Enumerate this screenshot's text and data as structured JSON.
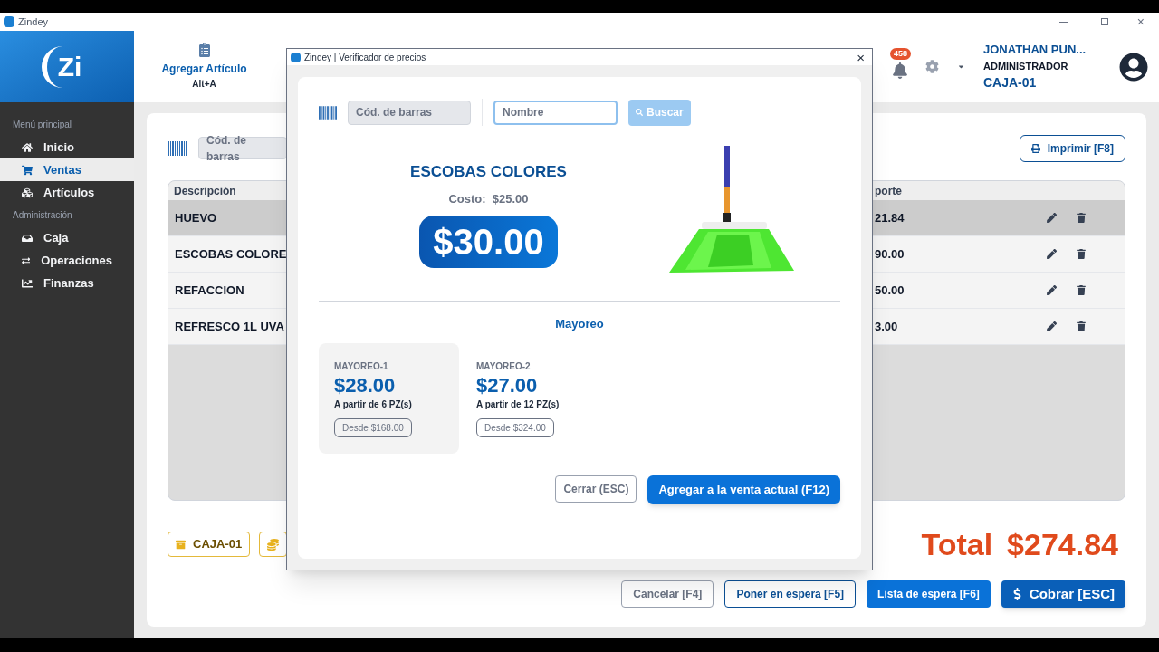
{
  "window": {
    "title": "Zindey",
    "close": "×"
  },
  "sidebar": {
    "logo": "Zi",
    "sections": [
      {
        "title": "Menú principal",
        "items": [
          {
            "label": "Inicio",
            "selected": false
          },
          {
            "label": "Ventas",
            "selected": true
          },
          {
            "label": "Artículos",
            "selected": false
          }
        ]
      },
      {
        "title": "Administración",
        "items": [
          {
            "label": "Caja",
            "selected": false
          },
          {
            "label": "Operaciones",
            "selected": false
          },
          {
            "label": "Finanzas",
            "selected": false
          }
        ]
      }
    ]
  },
  "toolbar": {
    "add_item": {
      "label": "Agregar Artículo",
      "shortcut": "Alt+A"
    },
    "notifications": "458",
    "user": {
      "name": "JONATHAN PUN...",
      "role": "ADMINISTRADOR",
      "register": "CAJA-01"
    }
  },
  "sale": {
    "barcode_placeholder": "Cód. de barras",
    "print_button": "Imprimir [F8]",
    "columns": [
      "Descripción",
      "porte"
    ],
    "rows": [
      {
        "description": "HUEVO",
        "amount": "21.84",
        "selected": true
      },
      {
        "description": "ESCOBAS COLORE",
        "amount": "90.00",
        "selected": false
      },
      {
        "description": "REFACCION",
        "amount": "50.00",
        "selected": false
      },
      {
        "description": "REFRESCO 1L UVA",
        "amount": "3.00",
        "selected": false
      }
    ],
    "register_tag": "CAJA-01",
    "total_label": "Total",
    "total": "$274.84",
    "buttons": [
      {
        "label": "Cancelar [F4]",
        "kind": "outline-gray"
      },
      {
        "label": "Poner en espera [F5]",
        "kind": "outline-blue"
      },
      {
        "label": "Lista de espera [F6]",
        "kind": "solid"
      },
      {
        "label": "Cobrar [ESC]",
        "kind": "primary"
      }
    ]
  },
  "dialog": {
    "title": "Zindey | Verificador de precios",
    "close": "×",
    "barcode_placeholder": "Cód. de barras",
    "name_placeholder": "Nombre",
    "search_button": "Buscar",
    "search_disabled": true,
    "product": {
      "name": "ESCOBAS COLORES",
      "cost_label": "Costo:",
      "cost": "$25.00",
      "price": "$30.00"
    },
    "wholesale_title": "Mayoreo",
    "wholesale": [
      {
        "name": "MAYOREO-1",
        "price": "$28.00",
        "condition": "A partir de 6 PZ(s)",
        "from": "Desde $168.00",
        "selected": true
      },
      {
        "name": "MAYOREO-2",
        "price": "$27.00",
        "condition": "A partir de 12 PZ(s)",
        "from": "Desde $324.00",
        "selected": false
      }
    ],
    "close_button": "Cerrar (ESC)",
    "add_button": "Agregar a la venta actual (F12)"
  }
}
